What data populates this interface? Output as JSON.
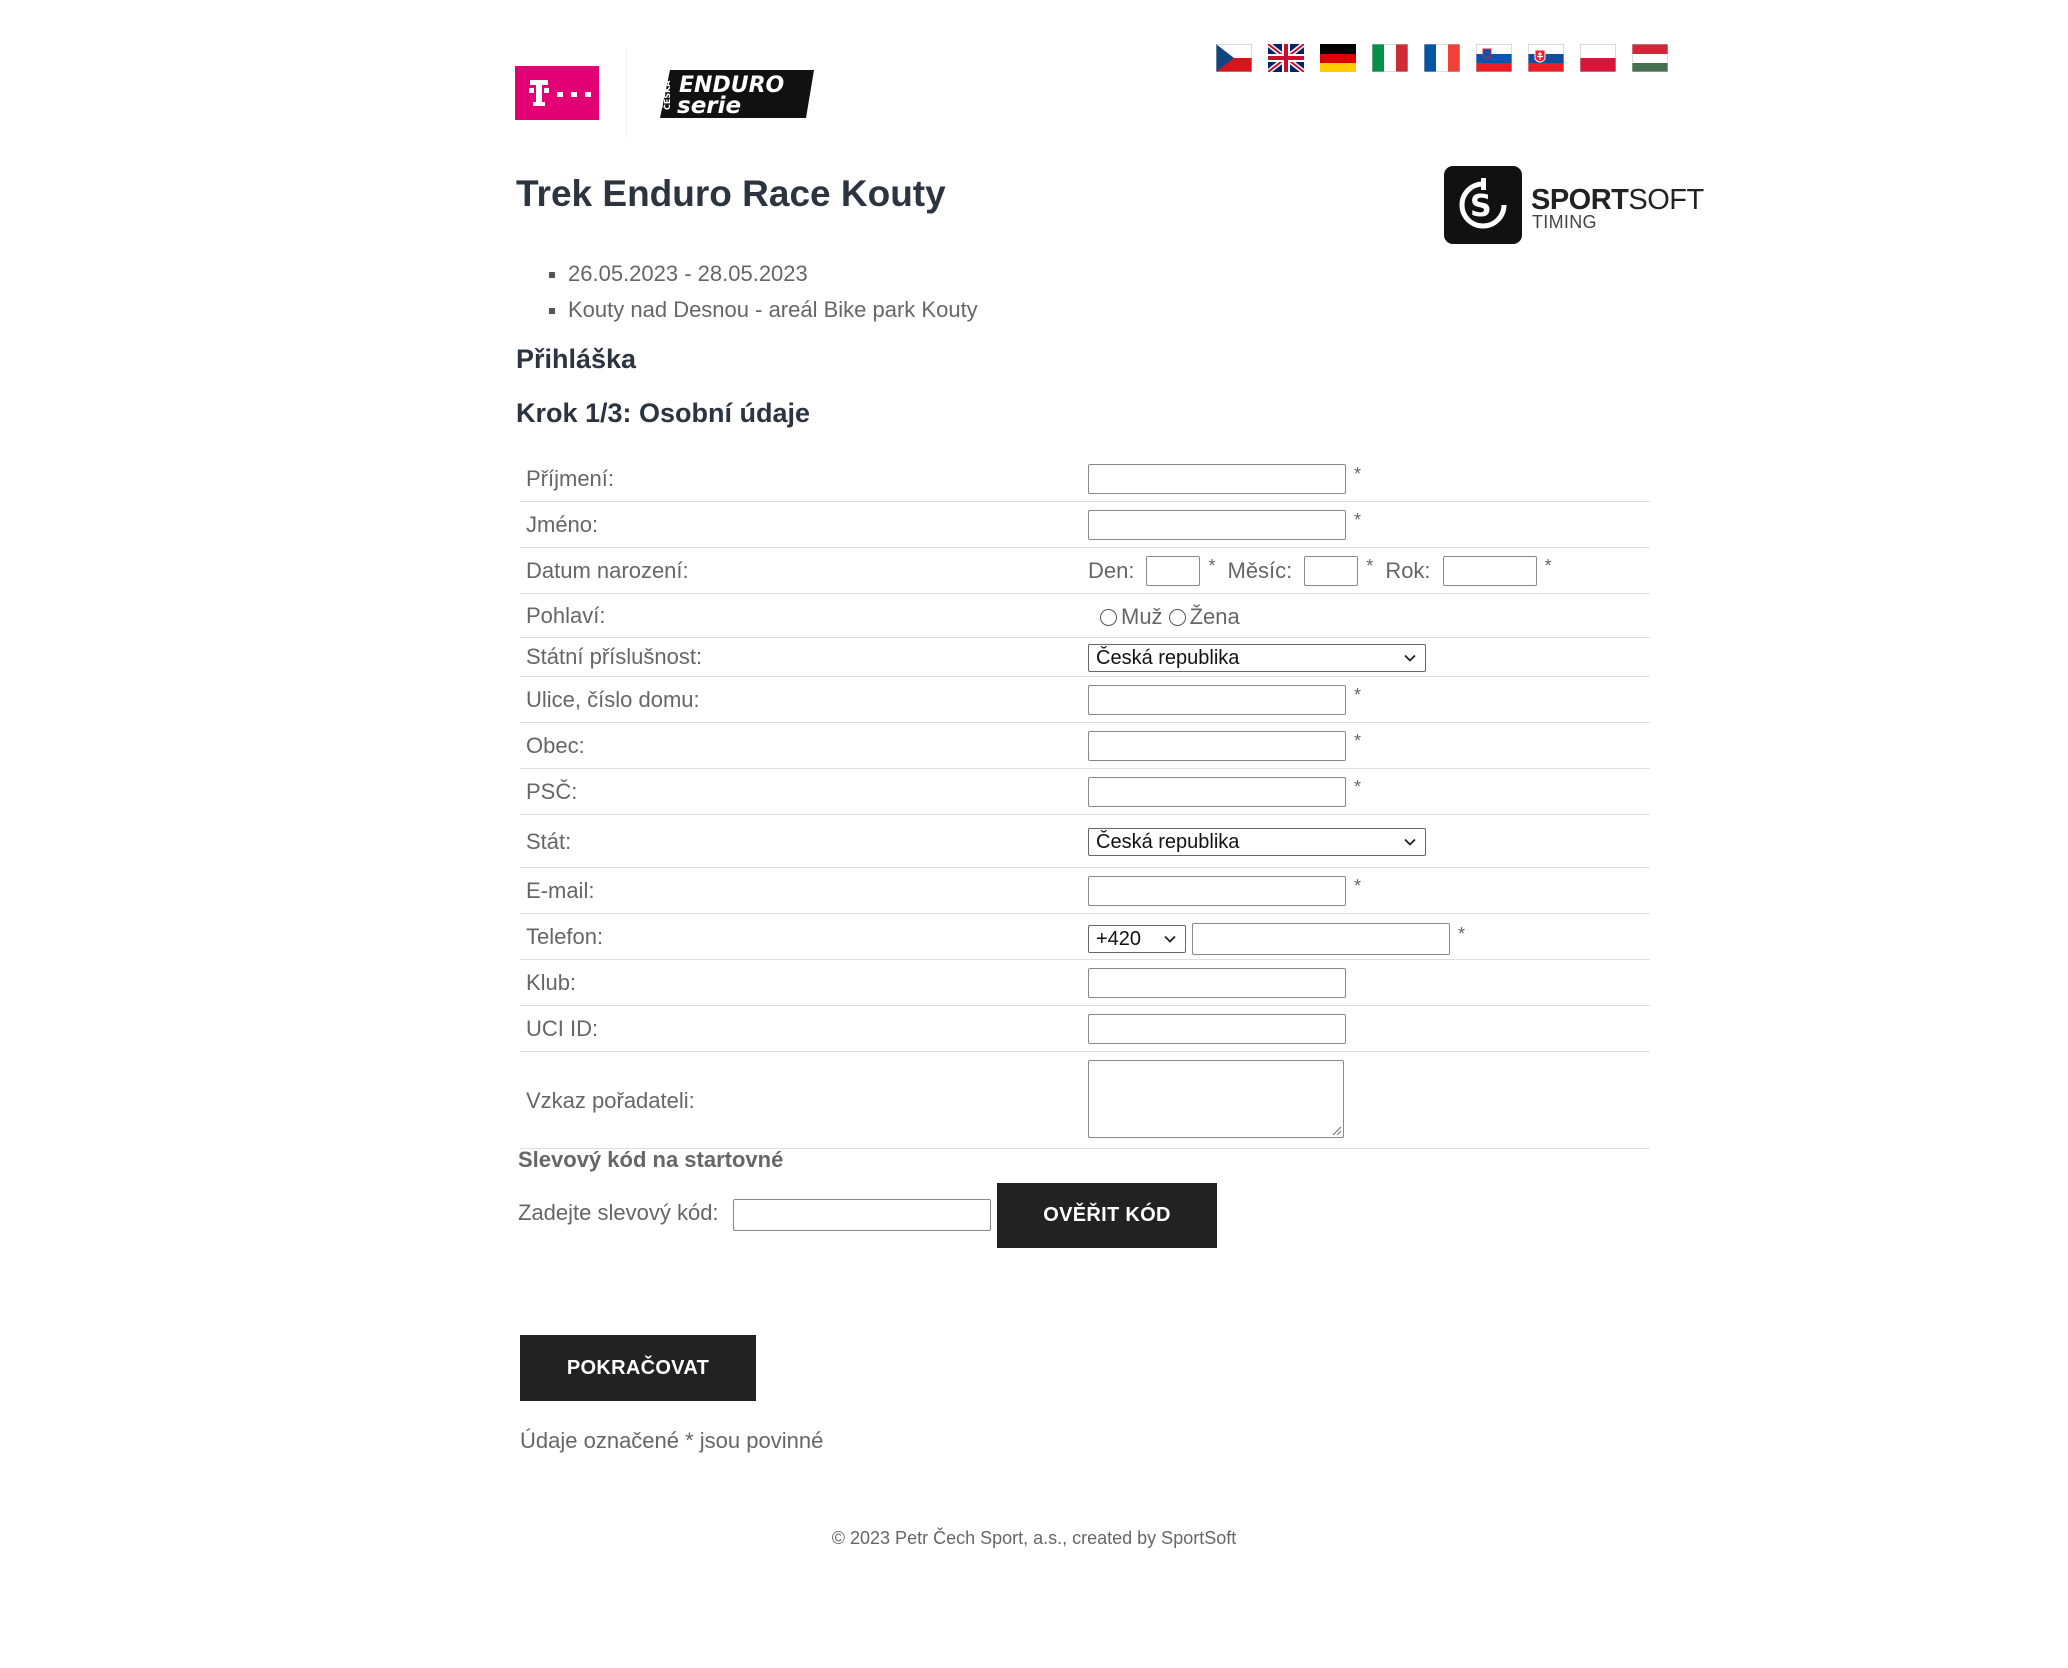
{
  "header": {
    "t_logo_text": "T··",
    "enduro_logo_text": "ČESKÁ ENDURO SERIE",
    "flags": [
      {
        "name": "czech-flag-icon"
      },
      {
        "name": "uk-flag-icon"
      },
      {
        "name": "german-flag-icon"
      },
      {
        "name": "italian-flag-icon"
      },
      {
        "name": "french-flag-icon"
      },
      {
        "name": "slovenian-flag-icon"
      },
      {
        "name": "slovak-flag-icon"
      },
      {
        "name": "polish-flag-icon"
      },
      {
        "name": "hungarian-flag-icon"
      }
    ],
    "sportsoft": {
      "line1_bold": "SPORT",
      "line1_light": "SOFT",
      "line2": "TIMING"
    }
  },
  "event": {
    "title": "Trek Enduro Race Kouty",
    "dates": "26.05.2023 - 28.05.2023",
    "location": "Kouty nad Desnou - areál Bike park Kouty"
  },
  "section_title": "Přihláška",
  "step_title": "Krok 1/3: Osobní údaje",
  "form": {
    "surname_label": "Příjmení:",
    "firstname_label": "Jméno:",
    "birthdate_label": "Datum narození:",
    "day_label": "Den:",
    "month_label": "Měsíc:",
    "year_label": "Rok:",
    "gender_label": "Pohlaví:",
    "gender_male": "Muž",
    "gender_female": "Žena",
    "nationality_label": "Státní příslušnost:",
    "nationality_value": "Česká republika",
    "street_label": "Ulice, číslo domu:",
    "city_label": "Obec:",
    "zip_label": "PSČ:",
    "country_label": "Stát:",
    "country_value": "Česká republika",
    "email_label": "E-mail:",
    "phone_label": "Telefon:",
    "phone_prefix": "+420",
    "club_label": "Klub:",
    "uci_label": "UCI ID:",
    "message_label": "Vzkaz pořadateli:",
    "required_mark": "*"
  },
  "discount": {
    "title": "Slevový kód na startovné",
    "label": "Zadejte slevový kód:",
    "button": "OVĚŘIT KÓD"
  },
  "continue_button": "POKRAČOVAT",
  "required_note": "Údaje označené * jsou povinné",
  "footer": "© 2023 Petr Čech Sport, a.s., created by SportSoft",
  "colors": {
    "telekom_magenta": "#e20074",
    "button_bg": "#222222",
    "heading": "#2c3440",
    "text": "#666666"
  }
}
